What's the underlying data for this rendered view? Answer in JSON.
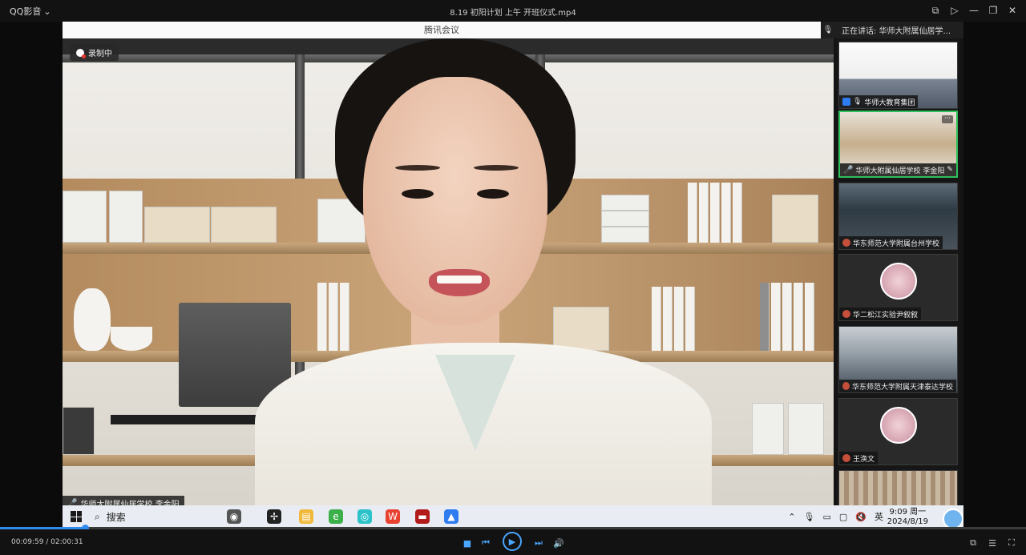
{
  "titlebar": {
    "app_name": "QQ影音",
    "file_title": "8.19 初阳计划 上午 开班仪式.mp4"
  },
  "meeting": {
    "app_title": "腾讯会议",
    "speaking_label": "正在讲话:",
    "speaking_name": "华师大附属仙居学..."
  },
  "stage": {
    "recording_label": "录制中",
    "speaker_name": "华师大附属仙居学校 李金阳"
  },
  "participants": [
    {
      "name": "华师大教育集团",
      "scene": "slide"
    },
    {
      "name": "华师大附属仙居学校 李金阳",
      "scene": "office",
      "active": true
    },
    {
      "name": "华东师范大学附属台州学校",
      "scene": "class"
    },
    {
      "name": "华二松江实验尹叙叙",
      "scene": "avatar"
    },
    {
      "name": "华东师范大学附属天津泰达学校",
      "scene": "hall"
    },
    {
      "name": "王涣文",
      "scene": "avatar"
    },
    {
      "name": "",
      "scene": "crowd"
    }
  ],
  "taskbar": {
    "search_label": "搜索",
    "lang": "英",
    "clock_time": "9:09 周一",
    "clock_date": "2024/8/19"
  },
  "playback": {
    "current_time": "00:09:59",
    "total_time": "02:00:31",
    "time_display": "00:09:59 / 02:00:31",
    "progress": 0.083
  },
  "colors": {
    "accent": "#2f8bf0",
    "active_border": "#2ec05a",
    "mic_active": "#3ecf5a"
  }
}
